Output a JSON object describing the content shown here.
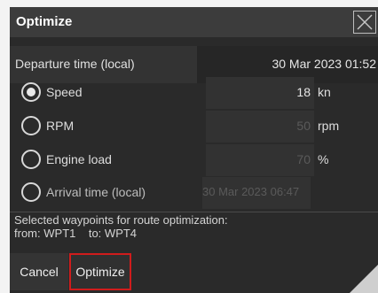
{
  "dialog": {
    "title": "Optimize"
  },
  "departure": {
    "label": "Departure time (local)",
    "value": "30 Mar 2023 01:52"
  },
  "options": {
    "speed": {
      "label": "Speed",
      "value": "18",
      "unit": "kn",
      "selected": true
    },
    "rpm": {
      "label": "RPM",
      "value": "50",
      "unit": "rpm",
      "selected": false
    },
    "engine_load": {
      "label": "Engine load",
      "value": "70",
      "unit": "%",
      "selected": false
    },
    "arrival": {
      "label": "Arrival time (local)",
      "value": "30 Mar 2023 06:47",
      "selected": false
    }
  },
  "info": {
    "line1": "Selected waypoints for route optimization:",
    "from_label": "from:",
    "from_value": "WPT1",
    "to_label": "to:",
    "to_value": "WPT4"
  },
  "buttons": {
    "cancel": "Cancel",
    "optimize": "Optimize"
  },
  "colors": {
    "highlight": "#d01c1c",
    "dialog_bg": "#2a2a2a"
  }
}
